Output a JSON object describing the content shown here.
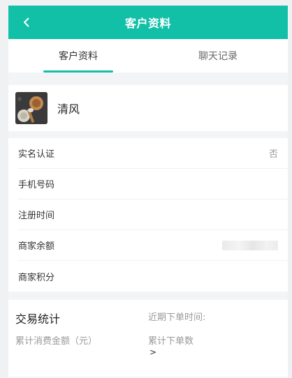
{
  "header": {
    "title": "客户资料"
  },
  "tabs": [
    {
      "label": "客户资料",
      "active": true
    },
    {
      "label": "聊天记录",
      "active": false
    }
  ],
  "profile": {
    "name": "清风"
  },
  "info_rows": [
    {
      "label": "实名认证",
      "value": "否"
    },
    {
      "label": "手机号码",
      "value": ""
    },
    {
      "label": "注册时间",
      "value": ""
    },
    {
      "label": "商家余额",
      "value": ""
    },
    {
      "label": "商家积分",
      "value": ""
    }
  ],
  "stats": {
    "title": "交易统计",
    "recent_order_label": "近期下单时间:",
    "total_consume_label": "累计消费金额（元）",
    "total_orders_label": "累计下单数",
    "more_symbol": ">"
  },
  "colors": {
    "accent": "#12bfa7"
  }
}
